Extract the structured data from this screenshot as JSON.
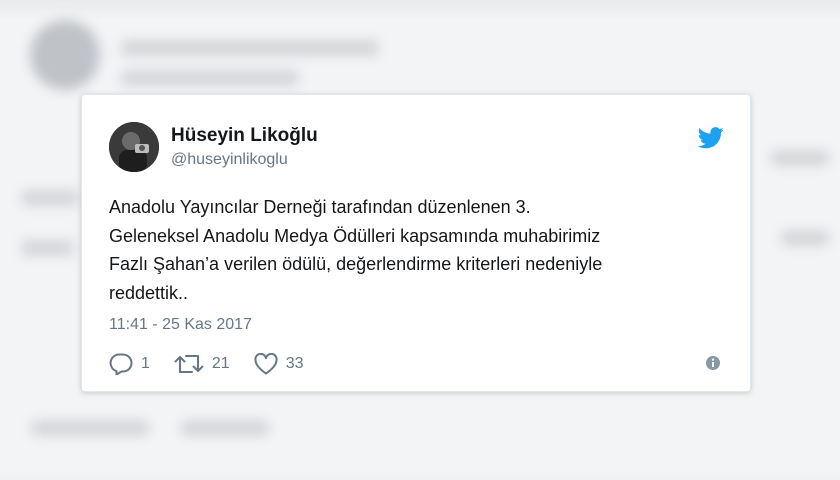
{
  "tweet": {
    "display_name": "Hüseyin Likoğlu",
    "handle": "@huseyinlikoglu",
    "text": "Anadolu Yayıncılar Derneği tarafından düzenlenen 3.\nGeleneksel Anadolu Medya Ödülleri kapsamında muhabirimiz\nFazlı Şahan’a verilen ödülü, değerlendirme kriterleri nedeniyle\nreddettik..",
    "timestamp": "11:41 - 25 Kas 2017",
    "replies": "1",
    "retweets": "21",
    "likes": "33"
  },
  "icons": {
    "brand": "twitter-bird-icon",
    "reply": "reply-icon",
    "retweet": "retweet-icon",
    "like": "heart-icon",
    "info": "info-icon"
  },
  "colors": {
    "twitter_blue": "#1da1f2",
    "text": "#14171a",
    "muted": "#657786"
  }
}
